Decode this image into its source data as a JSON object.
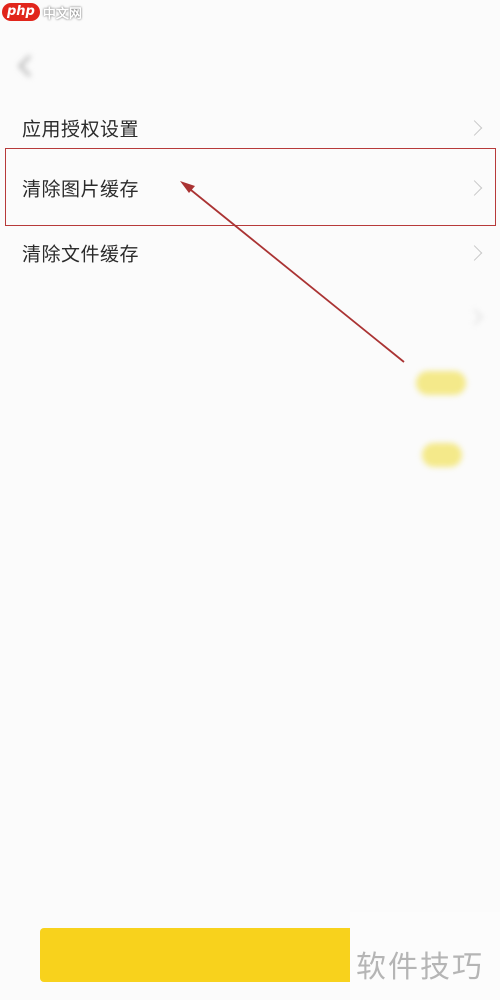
{
  "brand": {
    "badge": "php",
    "name": "中文网"
  },
  "status_bar": {
    "carrier": "",
    "time": "",
    "battery": ""
  },
  "nav": {
    "title": ""
  },
  "settings": {
    "rows": [
      {
        "label": "应用授权设置"
      },
      {
        "label": "清除图片缓存"
      },
      {
        "label": "清除文件缓存"
      },
      {
        "label": ""
      },
      {
        "label": ""
      },
      {
        "label": ""
      }
    ]
  },
  "bottom": {
    "logout_label": ""
  },
  "watermark": {
    "text": "软件技巧"
  },
  "colors": {
    "accent": "#f8d21c",
    "highlight": "#b73a3a",
    "arrow": "#c0392b"
  }
}
